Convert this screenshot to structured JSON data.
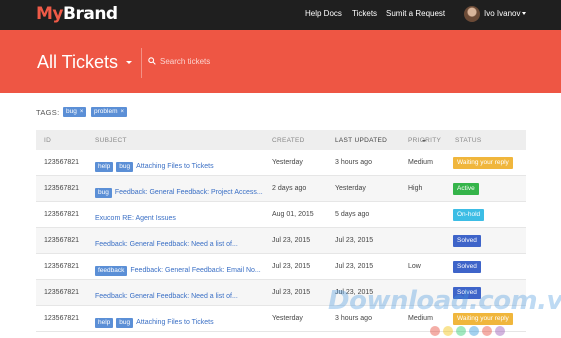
{
  "brand": {
    "part1": "My",
    "part2": "Brand"
  },
  "nav": {
    "links": [
      "Help Docs",
      "Tickets",
      "Sumit a Request"
    ],
    "user_name": "Ivo Ivanov"
  },
  "header": {
    "title": "All Tickets",
    "search_placeholder": "Search tickets"
  },
  "filters": {
    "label": "TAGS:",
    "tags": [
      "bug",
      "problem"
    ]
  },
  "table": {
    "columns": [
      "ID",
      "SUBJECT",
      "CREATED",
      "LAST UPDATED",
      "PRIORITY",
      "STATUS"
    ],
    "sorted_column": "LAST UPDATED",
    "rows": [
      {
        "id": "123567821",
        "tags": [
          "help",
          "bug"
        ],
        "subject": "Attaching Files to Tickets",
        "created": "Yesterday",
        "updated": "3 hours ago",
        "priority": "Medium",
        "status": "Waiting your reply",
        "status_color": "#f0b63c"
      },
      {
        "id": "123567821",
        "tags": [
          "bug"
        ],
        "subject": "Feedback: General Feedback: Project Access...",
        "created": "2 days ago",
        "updated": "Yesterday",
        "priority": "High",
        "status": "Active",
        "status_color": "#35b44a"
      },
      {
        "id": "123567821",
        "tags": [],
        "subject": "Exucom RE: Agent Issues",
        "created": "Aug 01, 2015",
        "updated": "5 days ago",
        "priority": "",
        "status": "On-hold",
        "status_color": "#3cbde5"
      },
      {
        "id": "123567821",
        "tags": [],
        "subject": "Feedback: General Feedback: Need a list of...",
        "created": "Jul 23, 2015",
        "updated": "Jul 23, 2015",
        "priority": "",
        "status": "Solved",
        "status_color": "#3e64c9"
      },
      {
        "id": "123567821",
        "tags": [
          "feedback"
        ],
        "subject": "Feedback: General Feedback: Email No...",
        "created": "Jul 23, 2015",
        "updated": "Jul 23, 2015",
        "priority": "Low",
        "status": "Solved",
        "status_color": "#3e64c9"
      },
      {
        "id": "123567821",
        "tags": [],
        "subject": "Feedback: General Feedback: Need a list of...",
        "created": "Jul 23, 2015",
        "updated": "Jul 23, 2015",
        "priority": "",
        "status": "Solved",
        "status_color": "#3e64c9"
      },
      {
        "id": "123567821",
        "tags": [
          "help",
          "bug"
        ],
        "subject": "Attaching Files to Tickets",
        "created": "Yesterday",
        "updated": "3 hours ago",
        "priority": "Medium",
        "status": "Waiting your reply",
        "status_color": "#f0b63c"
      }
    ]
  },
  "watermark": {
    "text": "Download.com.vn"
  },
  "colors": {
    "accent": "#ee5644",
    "nav_bg": "#1f1f1f",
    "tag": "#5b8fd6",
    "link": "#3a6fc5"
  }
}
